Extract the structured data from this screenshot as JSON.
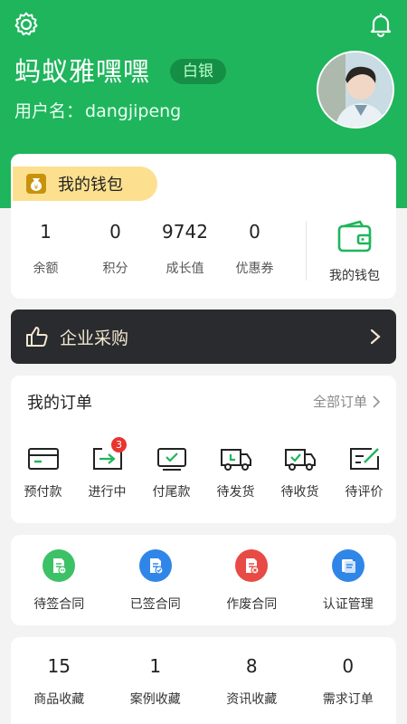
{
  "profile": {
    "name": "蚂蚁雅嘿嘿",
    "level": "白银",
    "account_label": "用户名：",
    "account_value": "dangjipeng"
  },
  "wallet": {
    "tag": "我的钱包",
    "stats": [
      {
        "value": "1",
        "label": "余额"
      },
      {
        "value": "0",
        "label": "积分"
      },
      {
        "value": "9742",
        "label": "成长值"
      },
      {
        "value": "0",
        "label": "优惠券"
      }
    ],
    "link_label": "我的钱包"
  },
  "enterprise": {
    "label": "企业采购",
    "chevron": "›"
  },
  "orders": {
    "title": "我的订单",
    "all_label": "全部订单",
    "items": [
      {
        "label": "预付款",
        "icon": "card-icon"
      },
      {
        "label": "进行中",
        "icon": "arrow-card-icon",
        "badge": "3"
      },
      {
        "label": "付尾款",
        "icon": "check-screen-icon"
      },
      {
        "label": "待发货",
        "icon": "truck-icon"
      },
      {
        "label": "待收货",
        "icon": "truck-check-icon"
      },
      {
        "label": "待评价",
        "icon": "edit-icon"
      }
    ]
  },
  "contracts": [
    {
      "label": "待签合同",
      "color": "#3cc166"
    },
    {
      "label": "已签合同",
      "color": "#2f86e8"
    },
    {
      "label": "作废合同",
      "color": "#e84a45"
    },
    {
      "label": "认证管理",
      "color": "#2f86e8"
    }
  ],
  "favorites": [
    {
      "value": "15",
      "label": "商品收藏"
    },
    {
      "value": "1",
      "label": "案例收藏"
    },
    {
      "value": "8",
      "label": "资讯收藏"
    },
    {
      "value": "0",
      "label": "需求订单"
    }
  ],
  "colors": {
    "brand": "#1fb55c",
    "badge": "#e8352f",
    "wallet_tag": "#fde08f",
    "dark_bar": "#2a2b2f"
  }
}
